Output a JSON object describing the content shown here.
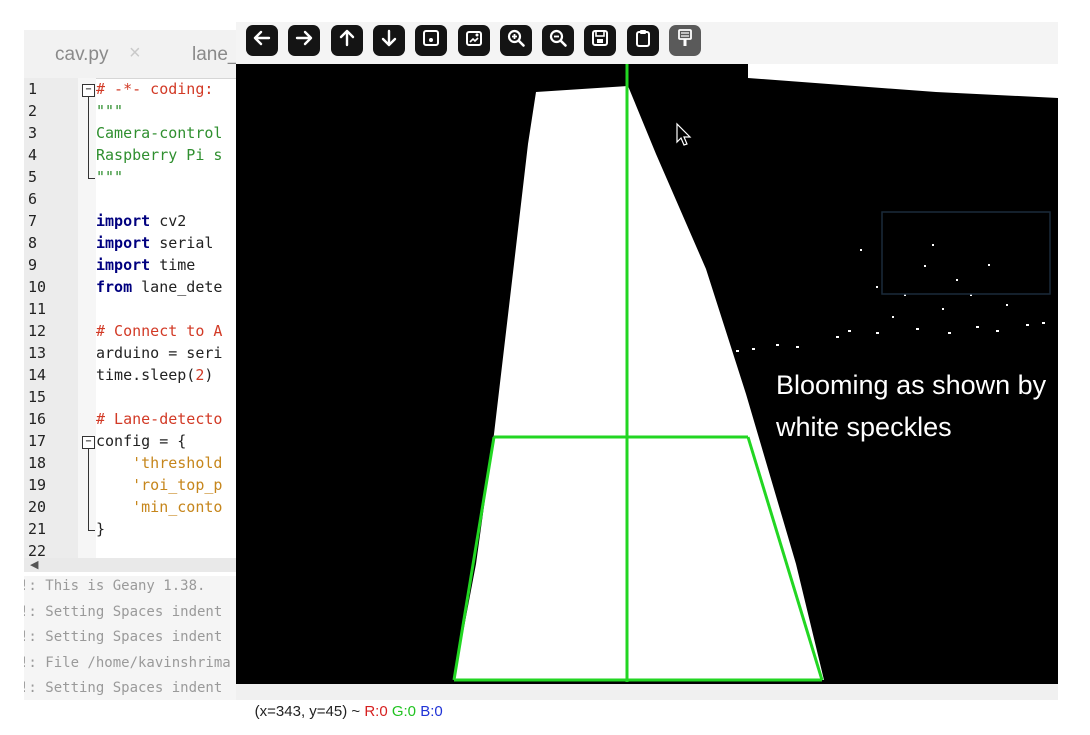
{
  "editor": {
    "tabs": [
      {
        "label": "cav.py",
        "close": "×"
      },
      {
        "label": "lane_"
      }
    ],
    "lines": [
      {
        "n": "1",
        "parts": [
          {
            "t": "# -*- coding:",
            "c": "cm"
          }
        ]
      },
      {
        "n": "2",
        "parts": [
          {
            "t": "\"\"\"",
            "c": "st"
          }
        ]
      },
      {
        "n": "3",
        "parts": [
          {
            "t": "Camera-control",
            "c": "st"
          }
        ]
      },
      {
        "n": "4",
        "parts": [
          {
            "t": "Raspberry Pi s",
            "c": "st"
          }
        ]
      },
      {
        "n": "5",
        "parts": [
          {
            "t": "\"\"\"",
            "c": "st"
          }
        ]
      },
      {
        "n": "6",
        "parts": []
      },
      {
        "n": "7",
        "parts": [
          {
            "t": "import",
            "c": "kw"
          },
          {
            "t": " cv2",
            "c": "pl"
          }
        ]
      },
      {
        "n": "8",
        "parts": [
          {
            "t": "import",
            "c": "kw"
          },
          {
            "t": " serial",
            "c": "pl"
          }
        ]
      },
      {
        "n": "9",
        "parts": [
          {
            "t": "import",
            "c": "kw"
          },
          {
            "t": " time",
            "c": "pl"
          }
        ]
      },
      {
        "n": "10",
        "parts": [
          {
            "t": "from",
            "c": "kw"
          },
          {
            "t": " lane_dete",
            "c": "pl"
          }
        ]
      },
      {
        "n": "11",
        "parts": []
      },
      {
        "n": "12",
        "parts": [
          {
            "t": "# Connect to A",
            "c": "cm"
          }
        ]
      },
      {
        "n": "13",
        "parts": [
          {
            "t": "arduino = seri",
            "c": "pl"
          }
        ]
      },
      {
        "n": "14",
        "parts": [
          {
            "t": "time.sleep(",
            "c": "pl"
          },
          {
            "t": "2",
            "c": "nm"
          },
          {
            "t": ")",
            "c": "pl"
          }
        ]
      },
      {
        "n": "15",
        "parts": []
      },
      {
        "n": "16",
        "parts": [
          {
            "t": "# Lane-detecto",
            "c": "cm"
          }
        ]
      },
      {
        "n": "17",
        "parts": [
          {
            "t": "config = {",
            "c": "pl"
          }
        ]
      },
      {
        "n": "18",
        "parts": [
          {
            "t": "    'threshold",
            "c": "sq"
          }
        ]
      },
      {
        "n": "19",
        "parts": [
          {
            "t": "    'roi_top_p",
            "c": "sq"
          }
        ]
      },
      {
        "n": "20",
        "parts": [
          {
            "t": "    'min_conto",
            "c": "sq"
          }
        ]
      },
      {
        "n": "21",
        "parts": [
          {
            "t": "}",
            "c": "pl"
          }
        ]
      },
      {
        "n": "22",
        "parts": []
      }
    ],
    "messages": [
      "!: This is Geany 1.38.",
      "!: Setting Spaces indent",
      "!: Setting Spaces indent",
      "!: File /home/kavinshrima",
      "!: Setting Spaces indent"
    ]
  },
  "image_window": {
    "toolbar": [
      {
        "name": "pan-left-button",
        "icon": "arrow-left-icon"
      },
      {
        "name": "pan-right-button",
        "icon": "arrow-right-icon"
      },
      {
        "name": "pan-up-button",
        "icon": "arrow-up-icon"
      },
      {
        "name": "pan-down-button",
        "icon": "arrow-down-icon"
      },
      {
        "name": "zoom-reset-button",
        "icon": "zoom-original-icon"
      },
      {
        "name": "zoom-fit-button",
        "icon": "zoom-fit-icon"
      },
      {
        "name": "zoom-in-button",
        "icon": "zoom-in-icon"
      },
      {
        "name": "zoom-out-button",
        "icon": "zoom-out-icon"
      },
      {
        "name": "save-image-button",
        "icon": "save-icon"
      },
      {
        "name": "copy-clipboard-button",
        "icon": "clipboard-icon"
      },
      {
        "name": "properties-button",
        "icon": "properties-icon",
        "inactive": true
      }
    ],
    "annotation": "Blooming as shown by white speckles",
    "status": {
      "coords": "(x=343, y=45) ~ ",
      "r": "R:0",
      "g": "G:0",
      "b": "B:0",
      "r_color": "#d62020",
      "g_color": "#21c321",
      "b_color": "#2033d6"
    },
    "overlay_color": "#22d622"
  }
}
